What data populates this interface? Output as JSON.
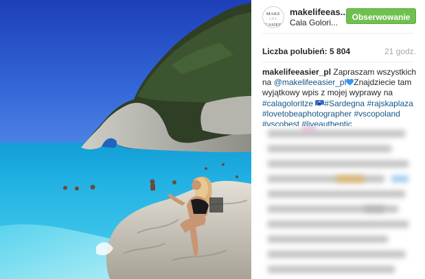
{
  "post": {
    "author": {
      "avatar_text": [
        "MAKE",
        "LIFE",
        "EASIER"
      ],
      "username": "makelifeeas...",
      "location": "Cala Golori..."
    },
    "follow_label": "Obserwowanie",
    "likes_label": "Liczba polubień:",
    "likes_count": "5 804",
    "time_ago": "21 godz.",
    "caption": {
      "username": "makelifeeasier_pl",
      "text_1": " Zapraszam wszystkich na ",
      "mention": "@makelifeeasier_pl",
      "text_2": "Znajdziecie tam wyjątkowy wpis z mojej wyprawy na ",
      "hashtags": [
        "#calagoloritze",
        "#Sardegna",
        "#rajskaplaza",
        "#lovetobeaphotographer",
        "#vscopoland",
        "#vscobest",
        "#liveauthentic"
      ]
    },
    "colors": {
      "follow_button": "#70c050",
      "link": "#125688",
      "heart_emoji": "#3897f0",
      "time": "#a5a7aa"
    },
    "icons": [
      "blue-heart-emoji",
      "surfer-emoji"
    ]
  }
}
